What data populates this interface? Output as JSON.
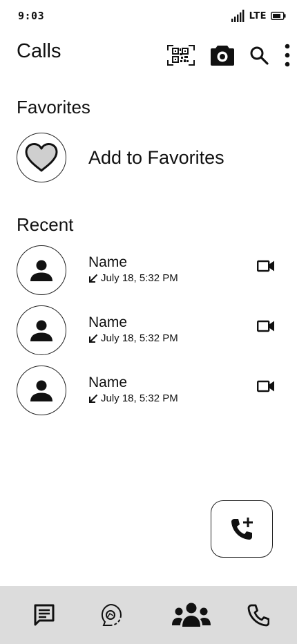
{
  "status_bar": {
    "time": "9:03",
    "network": "LTE",
    "icons": [
      "signal-icon",
      "battery-icon"
    ]
  },
  "app_bar": {
    "title": "Calls",
    "actions": [
      "qr-code-icon",
      "camera-icon",
      "search-icon",
      "more-vert-icon"
    ]
  },
  "favorites": {
    "title": "Favorites",
    "add_label": "Add to Favorites",
    "icon": "heart-icon"
  },
  "recent": {
    "title": "Recent",
    "calls": [
      {
        "name": "Name",
        "time": "July 18, 5:32 PM",
        "direction_icon": "incoming-arrow-icon",
        "action_icon": "video-call-icon"
      },
      {
        "name": "Name",
        "time": "July 18, 5:32 PM",
        "direction_icon": "incoming-arrow-icon",
        "action_icon": "video-call-icon"
      },
      {
        "name": "Name",
        "time": "July 18, 5:32 PM",
        "direction_icon": "incoming-arrow-icon",
        "action_icon": "video-call-icon"
      }
    ]
  },
  "fab": {
    "icon": "add-call-icon"
  },
  "bottom_nav": {
    "items": [
      "chats-icon",
      "updates-icon",
      "communities-icon",
      "calls-icon"
    ]
  },
  "colors": {
    "background": "#ffffff",
    "nav_background": "#dcdcdc",
    "icon": "#111111",
    "heart_fill": "#cfcfcf"
  }
}
